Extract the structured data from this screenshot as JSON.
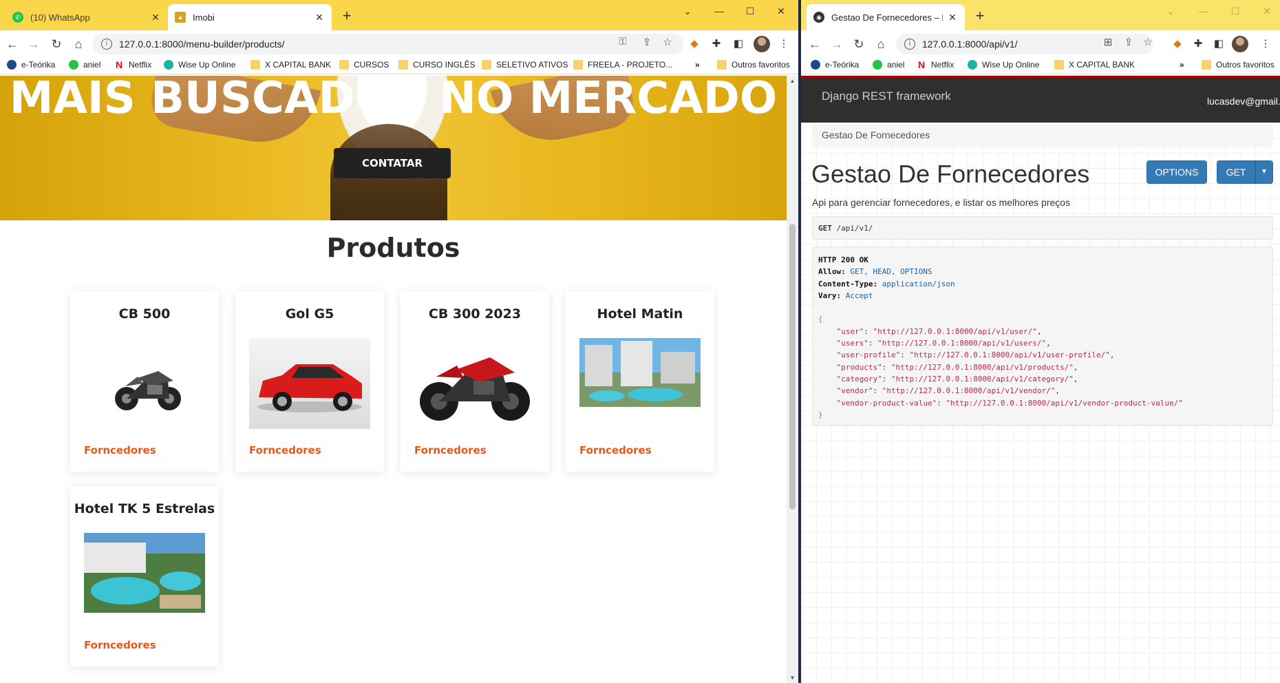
{
  "left": {
    "tabs": [
      {
        "title": "(10) WhatsApp",
        "close": "✕"
      },
      {
        "title": "Imobi",
        "close": "✕"
      }
    ],
    "url": "127.0.0.1:8000/menu-builder/products/",
    "bookmarks": [
      "e-Teórika",
      "aniel",
      "Netflix",
      "Wise Up Online",
      "X CAPITAL BANK",
      "CURSOS",
      "CURSO INGLÊS",
      "SELETIVO ATIVOS",
      "FREELA - PROJETO..."
    ],
    "bookmarks_more": "»",
    "bookmarks_other": "Outros favoritos",
    "hero": {
      "heading": "MAIS BUSCADOS NO MERCADO",
      "button": "CONTATAR"
    },
    "section_title": "Produtos",
    "products": [
      {
        "name": "CB 500",
        "link": "Forncedores"
      },
      {
        "name": "Gol G5",
        "link": "Forncedores"
      },
      {
        "name": "CB 300 2023",
        "link": "Forncedores"
      },
      {
        "name": "Hotel Matin",
        "link": "Forncedores"
      },
      {
        "name": "Hotel TK 5 Estrelas",
        "link": "Forncedores"
      }
    ]
  },
  "right": {
    "tabs": [
      {
        "title": "Gestao De Fornecedores – Djang",
        "close": "✕"
      }
    ],
    "url": "127.0.0.1:8000/api/v1/",
    "bookmarks": [
      "e-Teórika",
      "aniel",
      "Netflix",
      "Wise Up Online",
      "X CAPITAL BANK"
    ],
    "bookmarks_more": "»",
    "bookmarks_other": "Outros favoritos",
    "brand": "Django REST framework",
    "user": "lucasdev@gmail.com",
    "breadcrumb": "Gestao De Fornecedores",
    "title": "Gestao De Fornecedores",
    "options_label": "OPTIONS",
    "get_label": "GET",
    "description": "Api para gerenciar fornecedores, e listar os melhores preços",
    "request_method": "GET",
    "request_path": "/api/v1/",
    "response": {
      "status": "HTTP 200 OK",
      "headers": [
        {
          "name": "Allow:",
          "value": "GET, HEAD, OPTIONS"
        },
        {
          "name": "Content-Type:",
          "value": "application/json"
        },
        {
          "name": "Vary:",
          "value": "Accept"
        }
      ],
      "body": [
        {
          "key": "\"user\"",
          "value": "\"http://127.0.0.1:8000/api/v1/user/\"",
          "sep": ","
        },
        {
          "key": "\"users\"",
          "value": "\"http://127.0.0.1:8000/api/v1/users/\"",
          "sep": ","
        },
        {
          "key": "\"user-profile\"",
          "value": "\"http://127.0.0.1:8000/api/v1/user-profile/\"",
          "sep": ","
        },
        {
          "key": "\"products\"",
          "value": "\"http://127.0.0.1:8000/api/v1/products/\"",
          "sep": ","
        },
        {
          "key": "\"category\"",
          "value": "\"http://127.0.0.1:8000/api/v1/category/\"",
          "sep": ","
        },
        {
          "key": "\"vendor\"",
          "value": "\"http://127.0.0.1:8000/api/v1/vendor/\"",
          "sep": ","
        },
        {
          "key": "\"vendor-product-value\"",
          "value": "\"http://127.0.0.1:8000/api/v1/vendor-product-value/\"",
          "sep": ""
        }
      ]
    }
  },
  "colors": {
    "accent_orange": "#e8571a",
    "drf_blue": "#337ab7",
    "tab_strip": "#f9d64a"
  }
}
